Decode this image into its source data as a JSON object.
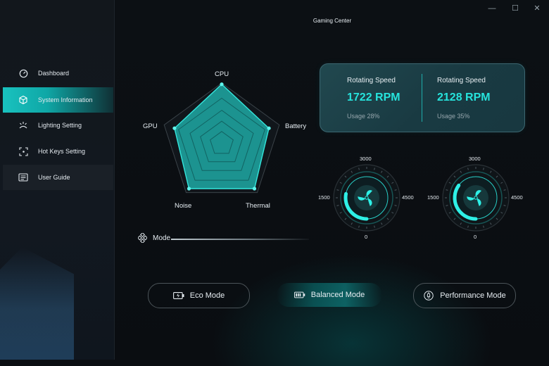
{
  "app": {
    "title": "Gaming Center"
  },
  "window_controls": {
    "minimize": "—",
    "maximize": "☐",
    "close": "✕"
  },
  "sidebar": {
    "items": [
      {
        "label": "Dashboard",
        "icon": "dashboard-icon",
        "active": false
      },
      {
        "label": "System Information",
        "icon": "cube-icon",
        "active": true
      },
      {
        "label": "Lighting Setting",
        "icon": "light-icon",
        "active": false
      },
      {
        "label": "Hot Keys Setting",
        "icon": "keyboard-focus-icon",
        "active": false
      },
      {
        "label": "User Guide",
        "icon": "guide-icon",
        "active": false
      }
    ]
  },
  "radar": {
    "labels": {
      "top": "CPU",
      "right": "Battery",
      "bottom_right": "Thermal",
      "bottom_left": "Noise",
      "left": "GPU"
    },
    "values": {
      "cpu": 0.98,
      "battery": 0.82,
      "thermal": 0.92,
      "noise": 0.92,
      "gpu": 0.82
    },
    "accent": "#1ec9c2"
  },
  "mode": {
    "label": "Mode"
  },
  "fan_panel": {
    "left": {
      "title": "Rotating Speed",
      "value": "1722 RPM",
      "usage": "Usage 28%"
    },
    "right": {
      "title": "Rotating Speed",
      "value": "2128 RPM",
      "usage": "Usage 35%"
    }
  },
  "gauges": {
    "left": {
      "top": "3000",
      "left": "1500",
      "right": "4500",
      "bottom": "0",
      "level": 0.28
    },
    "right": {
      "top": "3000",
      "left": "1500",
      "right": "4500",
      "bottom": "0",
      "level": 0.35
    }
  },
  "mode_buttons": [
    {
      "label": "Eco Mode",
      "icon": "eco-battery-icon",
      "active": false
    },
    {
      "label": "Balanced Mode",
      "icon": "battery-icon",
      "active": true
    },
    {
      "label": "Performance Mode",
      "icon": "rocket-icon",
      "active": false
    }
  ],
  "colors": {
    "accent": "#22e0d8",
    "panel": "#1d4148",
    "background": "#0b0e12"
  }
}
